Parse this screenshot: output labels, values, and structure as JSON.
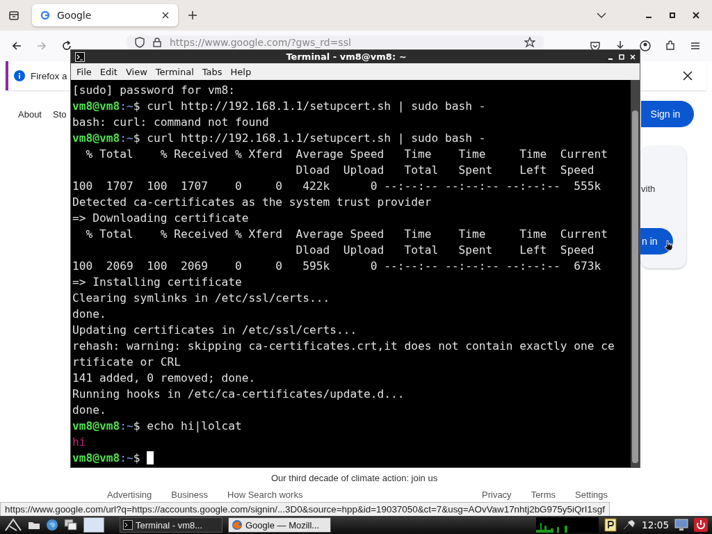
{
  "browser": {
    "tab": {
      "title": "Google",
      "selected": true
    },
    "url": "https://www.google.com/?gws_rd=ssl",
    "notice": "Firefox a",
    "nav": [
      "About",
      "Sto"
    ],
    "sign_in": "Sign in",
    "card": {
      "text": "vith",
      "button": "n in"
    },
    "promo": "Our third decade of climate action: join us",
    "footer_left": [
      "Advertising",
      "Business",
      "How Search works"
    ],
    "footer_right": [
      "Privacy",
      "Terms",
      "Settings"
    ],
    "status_url": "https://www.google.com/url?q=https://accounts.google.com/signin/...3D0&source=hpp&id=19037050&ct=7&usg=AOvVaw17nhtj2bG975y5iQrI1sgf"
  },
  "terminal": {
    "title": "Terminal - vm8@vm8: ~",
    "menu": [
      "File",
      "Edit",
      "View",
      "Terminal",
      "Tabs",
      "Help"
    ],
    "lines": [
      {
        "kind": "output",
        "text": "[sudo] password for vm8:"
      },
      {
        "kind": "prompt",
        "user": "vm8@vm8",
        "path": ":~",
        "sigil": "$",
        "command": "curl http://192.168.1.1/setupcert.sh | sudo bash -"
      },
      {
        "kind": "output",
        "text": "bash: curl: command not found"
      },
      {
        "kind": "prompt",
        "user": "vm8@vm8",
        "path": ":~",
        "sigil": "$",
        "command": "curl http://192.168.1.1/setupcert.sh | sudo bash -"
      },
      {
        "kind": "output",
        "text": "  % Total    % Received % Xferd  Average Speed   Time    Time     Time  Current"
      },
      {
        "kind": "output",
        "text": "                                 Dload  Upload   Total   Spent    Left  Speed"
      },
      {
        "kind": "output",
        "text": "100  1707  100  1707    0     0   422k      0 --:--:-- --:--:-- --:--:--  555k"
      },
      {
        "kind": "output",
        "text": "Detected ca-certificates as the system trust provider"
      },
      {
        "kind": "output",
        "text": "=> Downloading certificate"
      },
      {
        "kind": "output",
        "text": "  % Total    % Received % Xferd  Average Speed   Time    Time     Time  Current"
      },
      {
        "kind": "output",
        "text": "                                 Dload  Upload   Total   Spent    Left  Speed"
      },
      {
        "kind": "output",
        "text": "100  2069  100  2069    0     0   595k      0 --:--:-- --:--:-- --:--:--  673k"
      },
      {
        "kind": "output",
        "text": "=> Installing certificate"
      },
      {
        "kind": "output",
        "text": "Clearing symlinks in /etc/ssl/certs..."
      },
      {
        "kind": "output",
        "text": "done."
      },
      {
        "kind": "output",
        "text": "Updating certificates in /etc/ssl/certs..."
      },
      {
        "kind": "output",
        "text": "rehash: warning: skipping ca-certificates.crt,it does not contain exactly one ce"
      },
      {
        "kind": "output",
        "text": "rtificate or CRL"
      },
      {
        "kind": "output",
        "text": "141 added, 0 removed; done."
      },
      {
        "kind": "output",
        "text": "Running hooks in /etc/ca-certificates/update.d..."
      },
      {
        "kind": "output",
        "text": "done."
      },
      {
        "kind": "prompt",
        "user": "vm8@vm8",
        "path": ":~",
        "sigil": "$",
        "command": "echo hi|lolcat"
      },
      {
        "kind": "output",
        "text": "hi",
        "color": "#c8247a"
      },
      {
        "kind": "prompt",
        "user": "vm8@vm8",
        "path": ":~",
        "sigil": "$",
        "cursor": true
      }
    ]
  },
  "taskbar": {
    "tasks": [
      {
        "label": "Terminal - vm8...",
        "selected": false
      },
      {
        "label": "Google — Mozill...",
        "selected": true
      }
    ],
    "clock": "12:05"
  }
}
